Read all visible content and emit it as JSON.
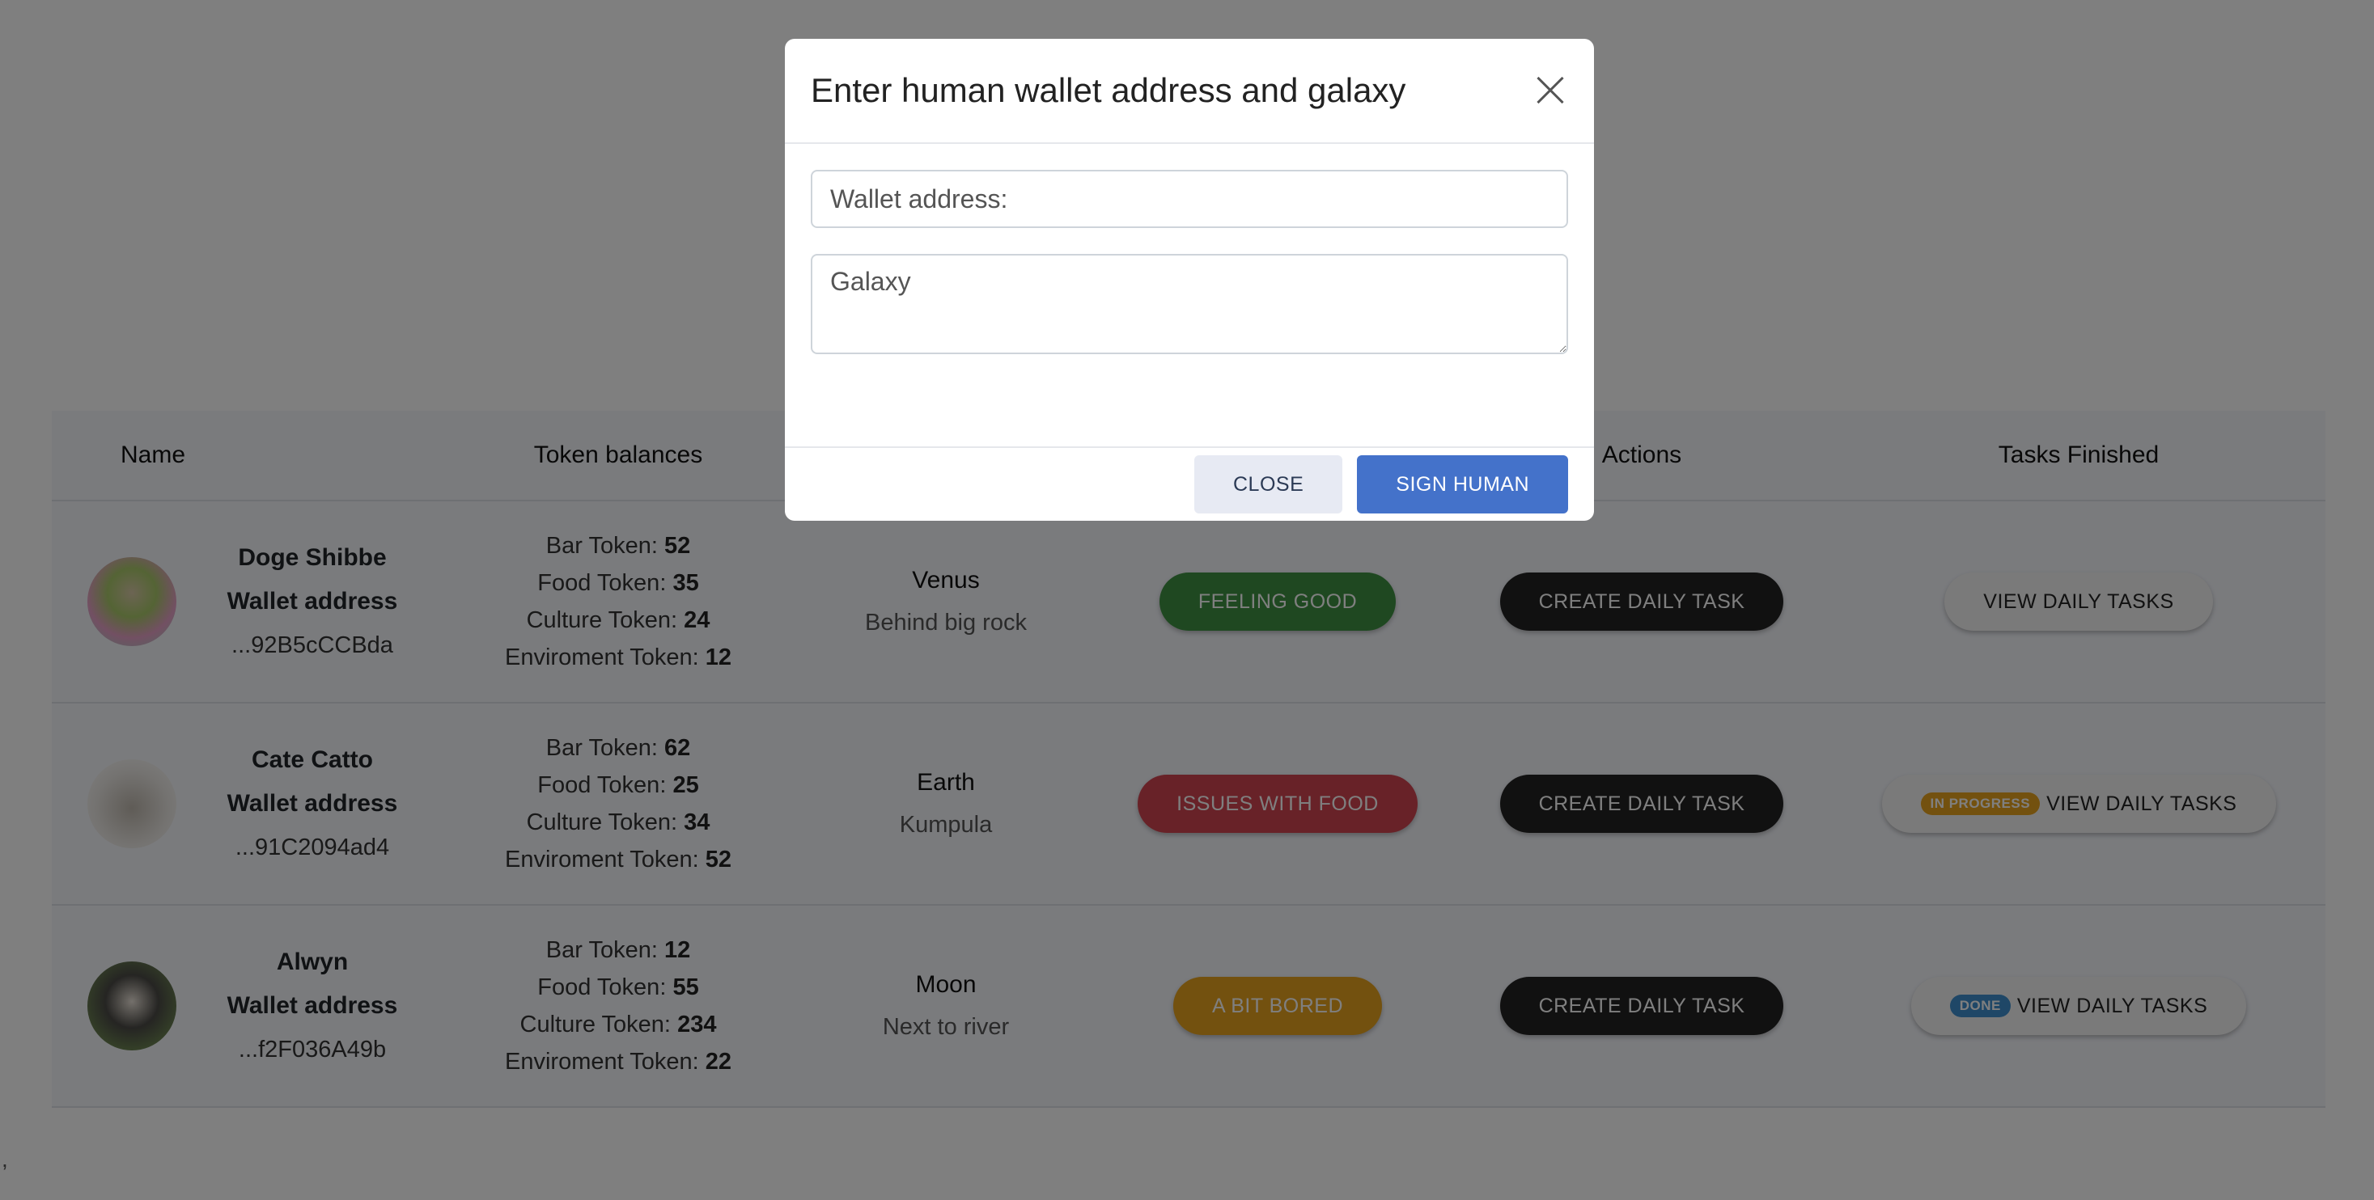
{
  "table": {
    "headers": {
      "name": "Name",
      "tokens": "Token balances",
      "location": "",
      "status": "",
      "actions": "Actions",
      "tasks": "Tasks Finished"
    },
    "rows": [
      {
        "name": "Doge Shibbe",
        "wallet_label": "Wallet address",
        "address": "...92B5cCCBda",
        "tokens": [
          {
            "label": "Bar Token: ",
            "value": "52"
          },
          {
            "label": "Food Token: ",
            "value": "35"
          },
          {
            "label": "Culture Token: ",
            "value": "24"
          },
          {
            "label": "Enviroment Token: ",
            "value": "12"
          }
        ],
        "planet": "Venus",
        "spot": "Behind big rock",
        "status": "FEELING GOOD",
        "action": "CREATE DAILY TASK",
        "tasks_badge": "",
        "tasks": "VIEW DAILY TASKS"
      },
      {
        "name": "Cate Catto",
        "wallet_label": "Wallet address",
        "address": "...91C2094ad4",
        "tokens": [
          {
            "label": "Bar Token: ",
            "value": "62"
          },
          {
            "label": "Food Token: ",
            "value": "25"
          },
          {
            "label": "Culture Token: ",
            "value": "34"
          },
          {
            "label": "Enviroment Token: ",
            "value": "52"
          }
        ],
        "planet": "Earth",
        "spot": "Kumpula",
        "status": "ISSUES WITH FOOD",
        "action": "CREATE DAILY TASK",
        "tasks_badge": "IN PROGRESS",
        "tasks": "VIEW DAILY TASKS"
      },
      {
        "name": "Alwyn",
        "wallet_label": "Wallet address",
        "address": "...f2F036A49b",
        "tokens": [
          {
            "label": "Bar Token: ",
            "value": "12"
          },
          {
            "label": "Food Token: ",
            "value": "55"
          },
          {
            "label": "Culture Token: ",
            "value": "234"
          },
          {
            "label": "Enviroment Token: ",
            "value": "22"
          }
        ],
        "planet": "Moon",
        "spot": "Next to river",
        "status": "A BIT BORED",
        "action": "CREATE DAILY TASK",
        "tasks_badge": "DONE",
        "tasks": "VIEW DAILY TASKS"
      }
    ]
  },
  "stray_text": ",",
  "modal": {
    "title": "Enter human wallet address and galaxy",
    "wallet_placeholder": "Wallet address:",
    "galaxy_placeholder": "Galaxy",
    "close_label": "CLOSE",
    "sign_label": "SIGN HUMAN"
  },
  "colors": {
    "primary": "#4472ca",
    "feeling_good": "#3f9142",
    "issues": "#d14550",
    "bored": "#e7a21e",
    "dark_button": "#222222",
    "overlay": "rgba(0,0,0,0.5)"
  }
}
